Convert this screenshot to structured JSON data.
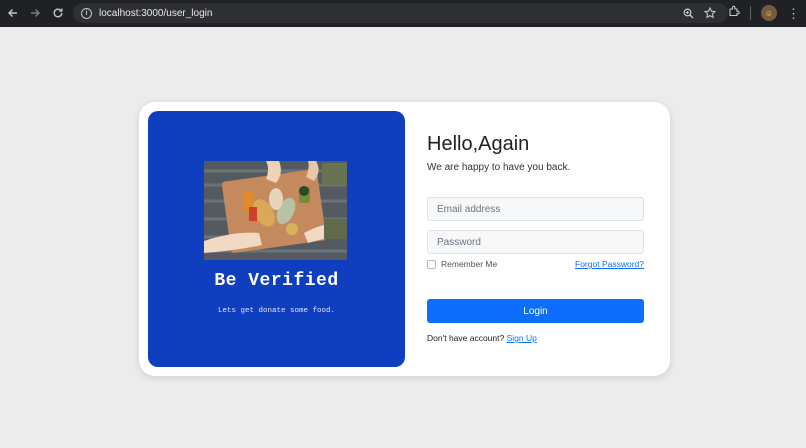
{
  "browser": {
    "url": "localhost:3000/user_login",
    "icons": [
      "back-arrow-icon",
      "forward-arrow-icon",
      "reload-icon",
      "site-info-icon",
      "zoom-icon",
      "star-icon",
      "extensions-icon",
      "profile-avatar",
      "menu-icon"
    ]
  },
  "banner": {
    "title": "Be Verified",
    "subtitle": "Lets get donate some food."
  },
  "form": {
    "heading": "Hello,Again",
    "subheading": "We are happy to have you back.",
    "email_placeholder": "Email address",
    "password_placeholder": "Password",
    "remember_label": "Remember Me",
    "forgot_label": "Forgot Password?",
    "login_label": "Login",
    "signup_prompt": "Don't have account?",
    "signup_label": "Sign Up"
  },
  "colors": {
    "banner_bg": "#0f3fbe",
    "primary": "#0d6efd",
    "page_bg": "#ececec"
  }
}
